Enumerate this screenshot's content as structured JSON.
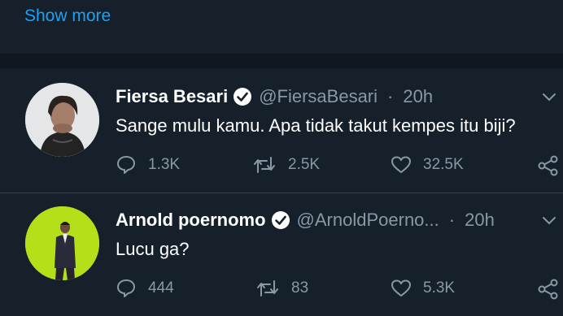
{
  "show_more": "Show more",
  "tweets": [
    {
      "name": "Fiersa Besari",
      "handle": "@FiersaBesari",
      "dot": "·",
      "time": "20h",
      "text": "Sange mulu kamu. Apa tidak takut kempes itu biji?",
      "replies": "1.3K",
      "retweets": "2.5K",
      "likes": "32.5K",
      "verified": true
    },
    {
      "name": "Arnold poernomo",
      "handle": "@ArnoldPoerno...",
      "dot": "·",
      "time": "20h",
      "text": "Lucu ga?",
      "replies": "444",
      "retweets": "83",
      "likes": "5.3K",
      "verified": true
    }
  ],
  "colors": {
    "background": "#15202b",
    "accent": "#1da1f2",
    "secondary_text": "#8899a6",
    "divider": "#38444d"
  }
}
